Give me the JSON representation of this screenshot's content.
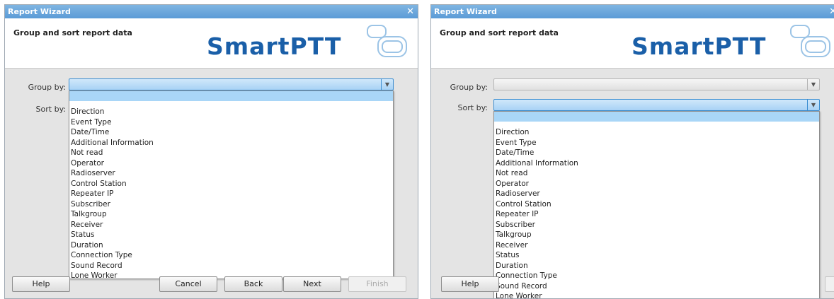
{
  "window": {
    "title": "Report Wizard",
    "close_glyph": "✕"
  },
  "header": {
    "title": "Group and sort report data",
    "logo_text": "SmartPTT"
  },
  "form": {
    "group_by_label": "Group by:",
    "sort_by_label": "Sort by:",
    "group_by_value": "",
    "sort_by_value": ""
  },
  "dropdown_options": [
    "Direction",
    "Event Type",
    "Date/Time",
    "Additional Information",
    "Not read",
    "Operator",
    "Radioserver",
    "Control Station",
    "Repeater IP",
    "Subscriber",
    "Talkgroup",
    "Receiver",
    "Status",
    "Duration",
    "Connection Type",
    "Sound Record",
    "Lone Worker"
  ],
  "buttons": {
    "help": "Help",
    "cancel": "Cancel",
    "back": "Back",
    "next": "Next",
    "finish": "Finish"
  },
  "colors": {
    "titlebar": "#5b9bd6",
    "selection": "#a9d6f7",
    "logo": "#1a5fa8"
  },
  "icons": {
    "dropdown_arrow": "chevron-down-icon",
    "close": "close-icon",
    "logo_shape": "logo-icon"
  }
}
